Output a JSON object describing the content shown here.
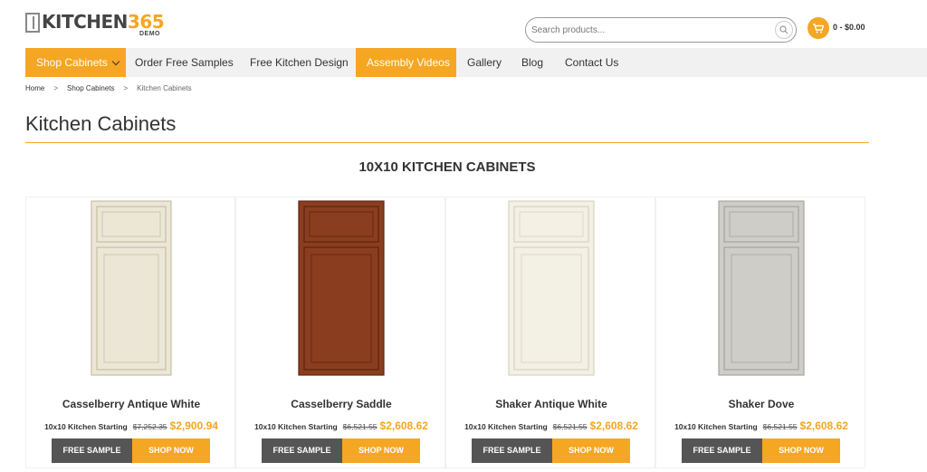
{
  "header": {
    "logo_main": "KITCHEN",
    "logo_num": "365",
    "logo_sub": "DEMO",
    "search_placeholder": "Search products...",
    "cart_text": "0 - $0.00"
  },
  "nav": {
    "items": [
      {
        "label": "Shop Cabinets"
      },
      {
        "label": "Order Free Samples"
      },
      {
        "label": "Free Kitchen Design"
      },
      {
        "label": "Assembly Videos"
      },
      {
        "label": "Gallery"
      },
      {
        "label": "Blog"
      },
      {
        "label": "Contact Us"
      }
    ]
  },
  "breadcrumb": {
    "items": [
      "Home",
      "Shop Cabinets",
      "Kitchen Cabinets"
    ],
    "separator": ">"
  },
  "page": {
    "title": "Kitchen Cabinets",
    "section_title": "10X10 KITCHEN CABINETS"
  },
  "products": [
    {
      "name": "Casselberry Antique White",
      "label": "10x10 Kitchen Starting",
      "old_price": "$7,252.35",
      "new_price": "$2,900.94",
      "sample_btn": "FREE SAMPLE",
      "shop_btn": "SHOP NOW",
      "door_color": "#ece6d6",
      "door_edge": "#c9bfa5"
    },
    {
      "name": "Casselberry Saddle",
      "label": "10x10 Kitchen Starting",
      "old_price": "$6,521.55",
      "new_price": "$2,608.62",
      "sample_btn": "FREE SAMPLE",
      "shop_btn": "SHOP NOW",
      "door_color": "#8b3e1f",
      "door_edge": "#5a2410"
    },
    {
      "name": "Shaker Antique White",
      "label": "10x10 Kitchen Starting",
      "old_price": "$6,521.55",
      "new_price": "$2,608.62",
      "sample_btn": "FREE SAMPLE",
      "shop_btn": "SHOP NOW",
      "door_color": "#f3f0e4",
      "door_edge": "#d8d3c2"
    },
    {
      "name": "Shaker Dove",
      "label": "10x10 Kitchen Starting",
      "old_price": "$6,521.55",
      "new_price": "$2,608.62",
      "sample_btn": "FREE SAMPLE",
      "shop_btn": "SHOP NOW",
      "door_color": "#cfcdc8",
      "door_edge": "#a6a39c"
    }
  ],
  "colors": {
    "accent": "#f5a623",
    "dark_button": "#555555",
    "nav_bg": "#f1f1f1"
  }
}
